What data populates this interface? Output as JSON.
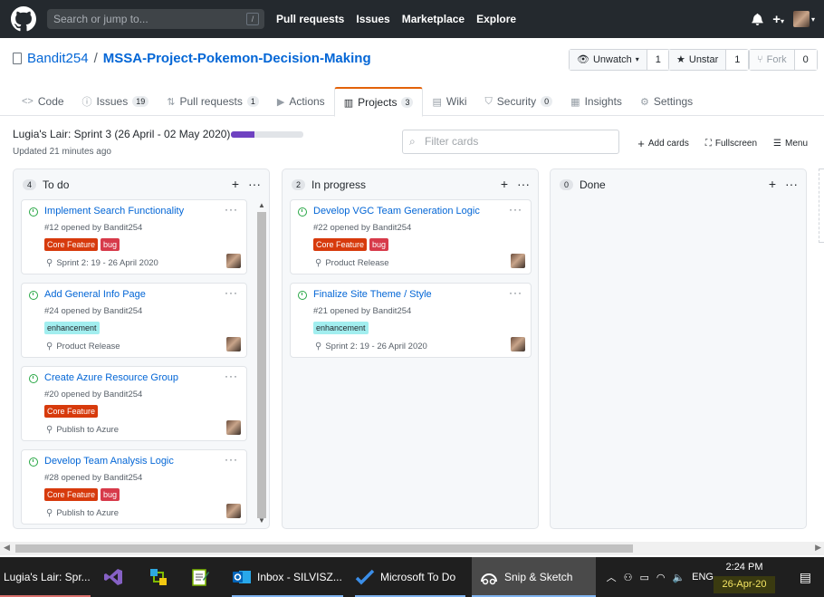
{
  "topbar": {
    "search_placeholder": "Search or jump to...",
    "search_key": "/",
    "nav": [
      "Pull requests",
      "Issues",
      "Marketplace",
      "Explore"
    ]
  },
  "repo": {
    "owner": "Bandit254",
    "separator": "/",
    "name": "MSSA-Project-Pokemon-Decision-Making",
    "watch_label": "Unwatch",
    "watch_count": "1",
    "star_label": "Unstar",
    "star_count": "1",
    "fork_label": "Fork",
    "fork_count": "0"
  },
  "tabs": [
    {
      "label": "Code",
      "icon": "code-icon",
      "count": ""
    },
    {
      "label": "Issues",
      "icon": "issue-icon",
      "count": "19"
    },
    {
      "label": "Pull requests",
      "icon": "pull-request-icon",
      "count": "1"
    },
    {
      "label": "Actions",
      "icon": "play-icon",
      "count": ""
    },
    {
      "label": "Projects",
      "icon": "project-icon",
      "count": "3",
      "active": true
    },
    {
      "label": "Wiki",
      "icon": "book-icon",
      "count": ""
    },
    {
      "label": "Security",
      "icon": "shield-icon",
      "count": "0"
    },
    {
      "label": "Insights",
      "icon": "graph-icon",
      "count": ""
    },
    {
      "label": "Settings",
      "icon": "gear-icon",
      "count": ""
    }
  ],
  "project": {
    "name": "Lugia's Lair: Sprint 3 (26 April - 02 May 2020)",
    "progress": 0.32,
    "updated": "Updated 21 minutes ago",
    "filter_placeholder": "Filter cards",
    "add_cards": "Add cards",
    "fullscreen": "Fullscreen",
    "menu": "Menu"
  },
  "colors": {
    "core_feature": "#d73a0c",
    "bug": "#d73a4a",
    "enhancement": "#a2eeef",
    "progress": "#6f42c1"
  },
  "columns": [
    {
      "count": "4",
      "name": "To do",
      "cards": [
        {
          "title": "Implement Search Functionality",
          "meta": "#12 opened by Bandit254",
          "labels": [
            "Core Feature",
            "bug"
          ],
          "milestone": "Sprint 2: 19 - 26 April 2020"
        },
        {
          "title": "Add General Info Page",
          "meta": "#24 opened by Bandit254",
          "labels": [
            "enhancement"
          ],
          "milestone": "Product Release"
        },
        {
          "title": "Create Azure Resource Group",
          "meta": "#20 opened by Bandit254",
          "labels": [
            "Core Feature"
          ],
          "milestone": "Publish to Azure"
        },
        {
          "title": "Develop Team Analysis Logic",
          "meta": "#28 opened by Bandit254",
          "labels": [
            "Core Feature",
            "bug"
          ],
          "milestone": "Publish to Azure"
        }
      ]
    },
    {
      "count": "2",
      "name": "In progress",
      "cards": [
        {
          "title": "Develop VGC Team Generation Logic",
          "meta": "#22 opened by Bandit254",
          "labels": [
            "Core Feature",
            "bug"
          ],
          "milestone": "Product Release"
        },
        {
          "title": "Finalize Site Theme / Style",
          "meta": "#21 opened by Bandit254",
          "labels": [
            "enhancement"
          ],
          "milestone": "Sprint 2: 19 - 26 April 2020"
        }
      ]
    },
    {
      "count": "0",
      "name": "Done",
      "cards": []
    }
  ],
  "taskbar": {
    "items": [
      "Lugia's Lair: Spr...",
      "Inbox - SILVISZ...",
      "Microsoft To Do",
      "Snip & Sketch"
    ],
    "lang": "ENG",
    "time": "2:24 PM",
    "date": "26-Apr-20"
  }
}
